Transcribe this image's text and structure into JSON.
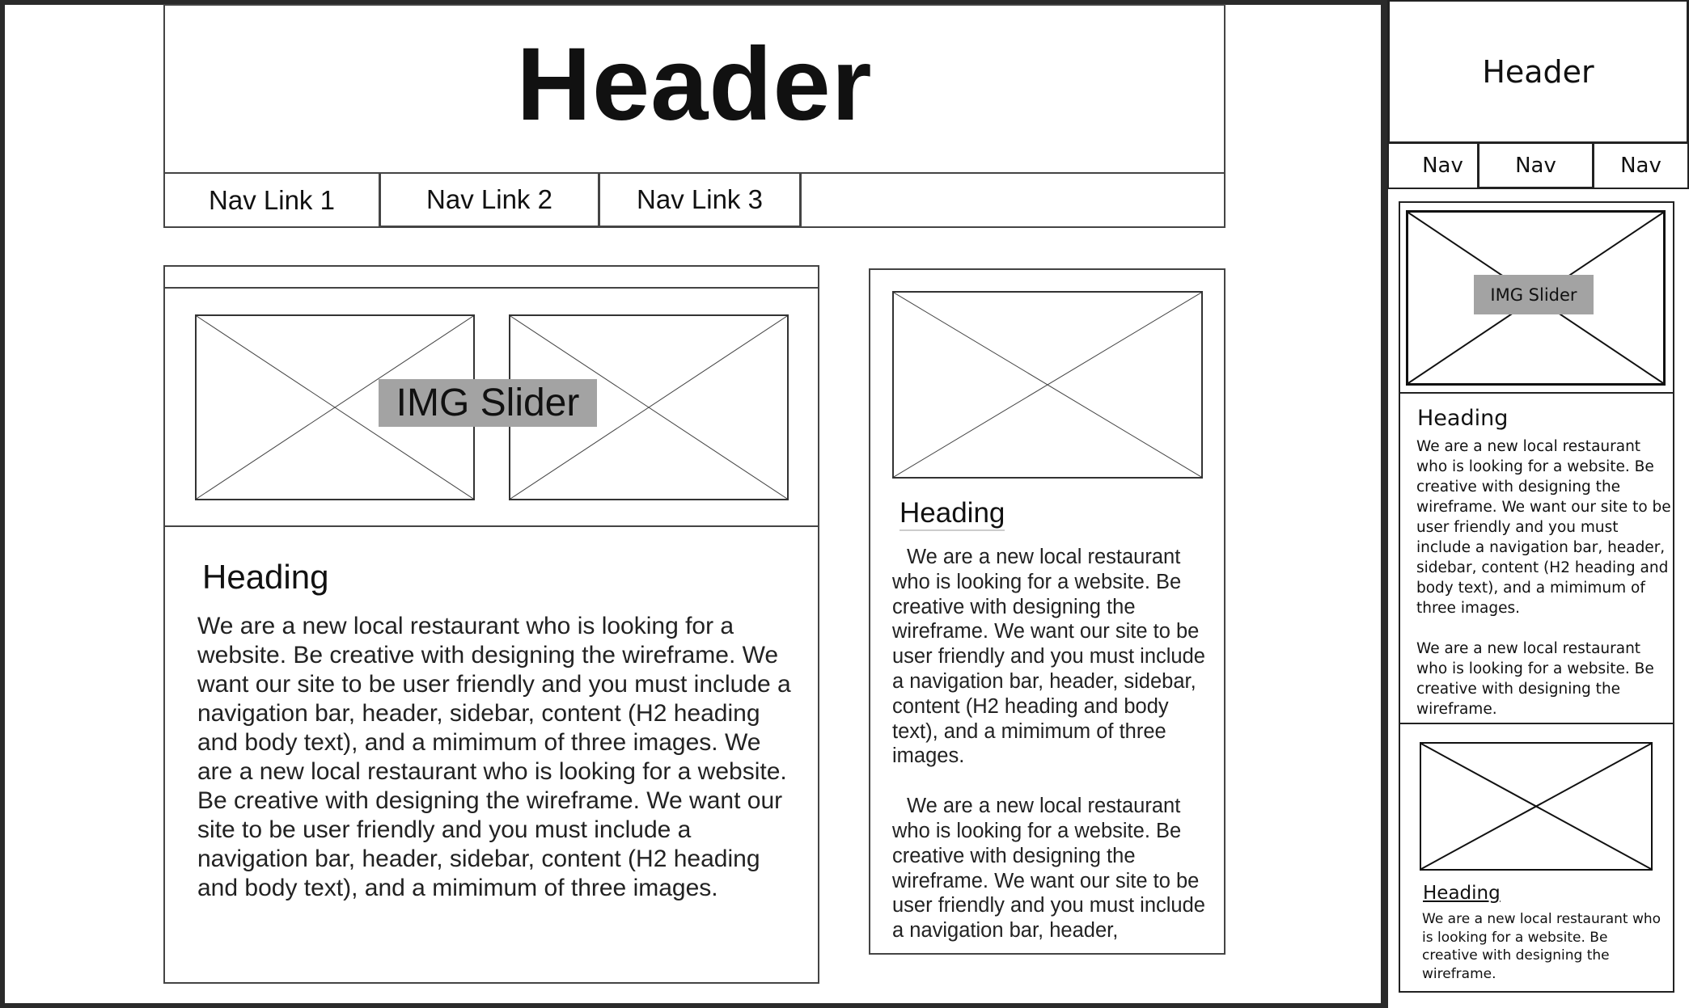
{
  "desktop": {
    "header": {
      "title": "Header"
    },
    "nav": {
      "links": [
        {
          "label": "Nav Link 1"
        },
        {
          "label": "Nav Link 2"
        },
        {
          "label": "Nav Link 3"
        }
      ]
    },
    "main": {
      "slider_label": "IMG Slider",
      "heading": "Heading",
      "body": "We are a new local restaurant who is looking for a website. Be creative with designing the wireframe. We want our site to be user friendly and you must include a navigation bar, header, sidebar, content (H2 heading and body text), and a mimimum of three images. We are a new local restaurant who is looking for a website. Be creative with designing the wireframe. We want our site to be user friendly and you must include a navigation bar, header, sidebar, content (H2 heading and body text), and a mimimum of three images."
    },
    "sidebar": {
      "heading": "Heading",
      "paragraphs": [
        "We are a new local restaurant who is looking for a website. Be creative with designing the wireframe. We want our site to be user friendly and you must include a navigation bar, header, sidebar, content (H2 heading and body text), and a mimimum of three images.",
        "We are a new local restaurant who is looking for a website. Be creative with designing the wireframe. We want our site to be user friendly and you must include a navigation bar, header,"
      ]
    }
  },
  "mobile": {
    "header": {
      "title": "Header"
    },
    "nav": {
      "links": [
        {
          "label": "Nav"
        },
        {
          "label": "Nav"
        },
        {
          "label": "Nav"
        }
      ]
    },
    "slider_label": "IMG Slider",
    "section1": {
      "heading": "Heading",
      "paragraphs": [
        "We are a new local restaurant who is looking for a website. Be creative with designing the wireframe. We want our site to be user friendly and you must include a navigation bar, header, sidebar, content (H2 heading and body text), and a mimimum of three images.",
        "We are a new local restaurant who is looking for a website. Be creative with designing the wireframe."
      ]
    },
    "section2": {
      "heading": "Heading",
      "body": "We are a new local restaurant who is looking for a website. Be creative with designing the wireframe."
    }
  }
}
